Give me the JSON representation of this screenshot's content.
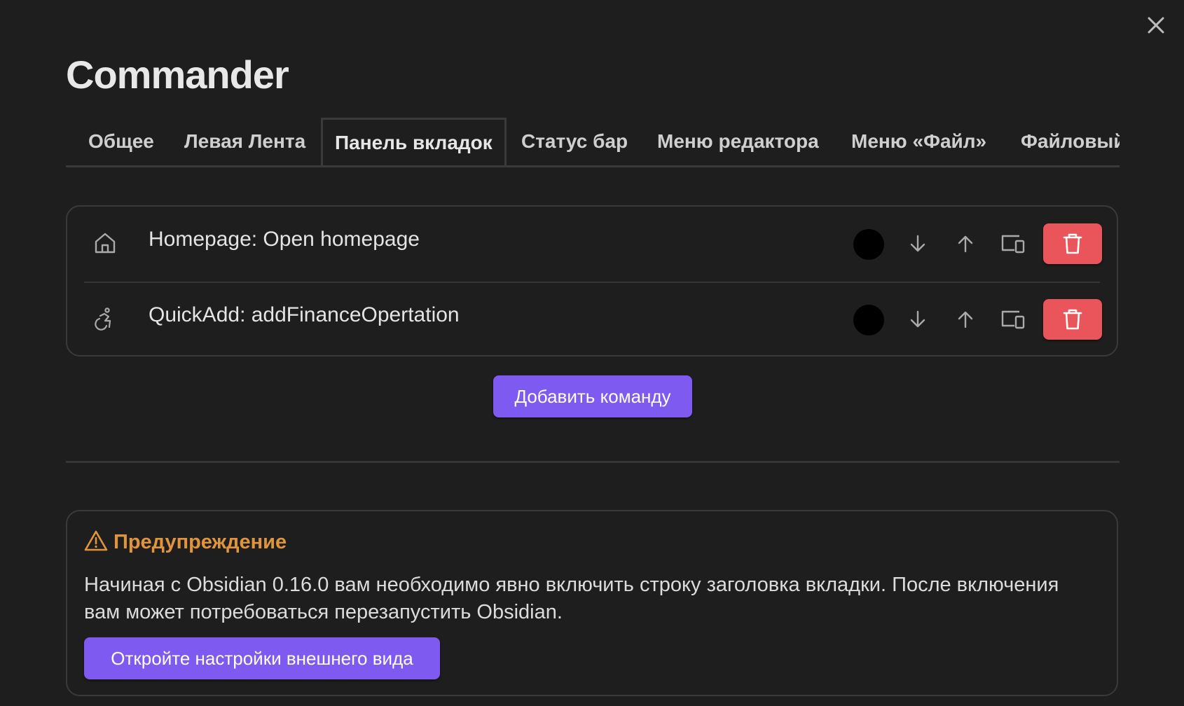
{
  "title": "Commander",
  "tabs": [
    {
      "label": "Общее"
    },
    {
      "label": "Левая Лента"
    },
    {
      "label": "Панель вкладок"
    },
    {
      "label": "Статус бар"
    },
    {
      "label": "Меню редактора"
    },
    {
      "label": "Меню «Файл»"
    },
    {
      "label": "Файловый"
    }
  ],
  "active_tab": "Панель вкладок",
  "commands": [
    {
      "name": "Homepage: Open homepage",
      "icon": "home-icon",
      "color": "#000000"
    },
    {
      "name": "QuickAdd: addFinanceOpertation",
      "icon": "accessibility-icon",
      "color": "#000000"
    }
  ],
  "add_button_label": "Добавить команду",
  "warning": {
    "title": "Предупреждение",
    "text": "Начиная с Obsidian 0.16.0 вам необходимо явно включить строку заголовка вкладки. После включения вам может потребоваться перезапустить Obsidian.",
    "button_label": "Откройте настройки внешнего вида"
  },
  "colors": {
    "background": "#1e1e1e",
    "accent": "#7f5af0",
    "danger": "#e9555a",
    "warning": "#e0953c"
  }
}
